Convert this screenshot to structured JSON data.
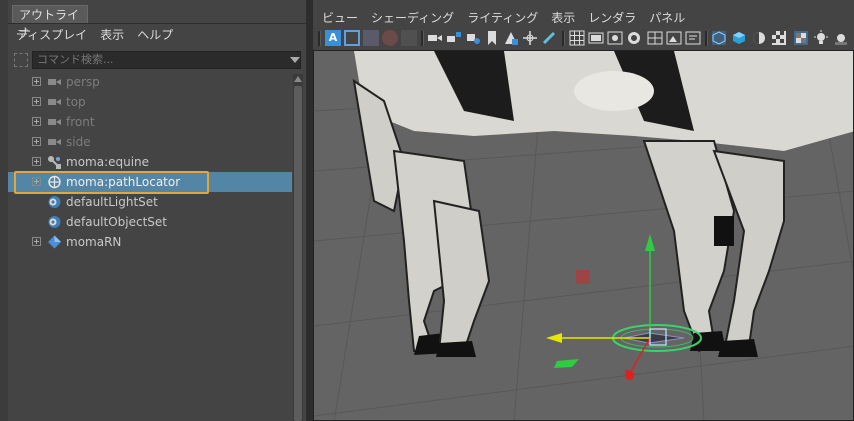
{
  "outliner": {
    "title": "アウトライナ",
    "menu": [
      "ディスプレイ",
      "表示",
      "ヘルプ"
    ],
    "search_placeholder": "コマンド検索...",
    "items": [
      {
        "label": "persp",
        "icon": "camera-icon",
        "dim": true
      },
      {
        "label": "top",
        "icon": "camera-icon",
        "dim": true
      },
      {
        "label": "front",
        "icon": "camera-icon",
        "dim": true
      },
      {
        "label": "side",
        "icon": "camera-icon",
        "dim": true
      },
      {
        "label": "moma:equine",
        "icon": "joint-hierarchy-icon",
        "dim": false
      },
      {
        "label": "moma:pathLocator",
        "icon": "locator-icon",
        "dim": false,
        "selected": true
      },
      {
        "label": "defaultLightSet",
        "icon": "set-icon",
        "dim": false
      },
      {
        "label": "defaultObjectSet",
        "icon": "set-icon",
        "dim": false
      },
      {
        "label": "momaRN",
        "icon": "reference-node-icon",
        "dim": false
      }
    ]
  },
  "viewport": {
    "menu": [
      "ビュー",
      "シェーディング",
      "ライティング",
      "表示",
      "レンダラ",
      "パネル"
    ],
    "toolbar_icons": [
      "select-camera-icon",
      "camera-attributes-icon",
      "bookmark-icon",
      "image-plane-icon",
      "grease-pencil-icon",
      "grid-icon",
      "film-gate-icon",
      "resolution-gate-icon",
      "gate-mask-icon",
      "field-chart-icon",
      "safe-action-icon",
      "wireframe-icon",
      "smooth-shade-icon",
      "default-material-icon",
      "textured-icon",
      "lights-icon"
    ],
    "colors": {
      "selection": "#5285a6",
      "highlight_outline": "#e6a43a",
      "manip_y": "#2ecc40",
      "manip_x": "#e6e600",
      "manip_z": "#e02020",
      "locator_ring": "#39d36b"
    }
  }
}
